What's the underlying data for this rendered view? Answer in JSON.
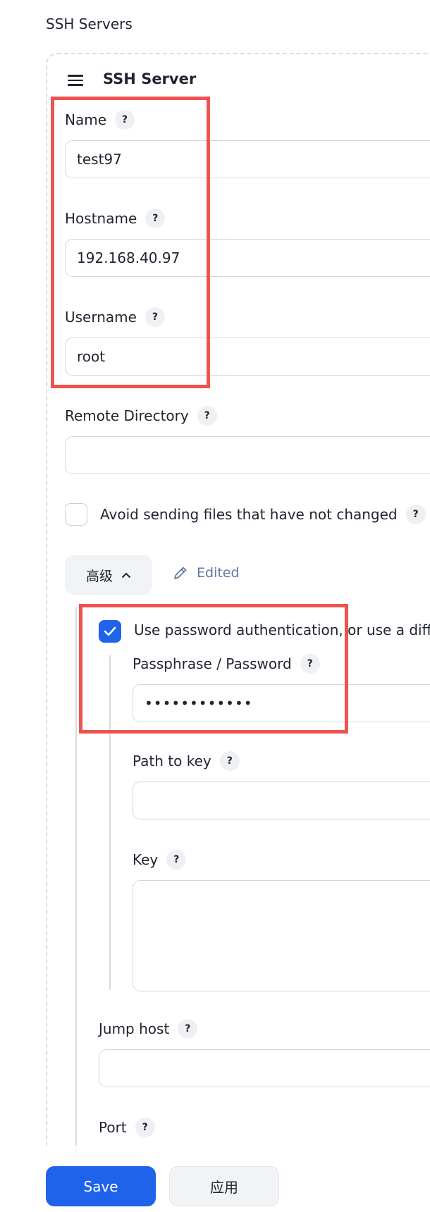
{
  "section": {
    "title": "SSH Servers"
  },
  "card": {
    "title": "SSH Server"
  },
  "fields": {
    "name": {
      "label": "Name",
      "value": "test97"
    },
    "hostname": {
      "label": "Hostname",
      "value": "192.168.40.97"
    },
    "username": {
      "label": "Username",
      "value": "root"
    },
    "remote_directory": {
      "label": "Remote Directory",
      "value": ""
    },
    "avoid_sending": {
      "label": "Avoid sending files that have not changed",
      "checked": false
    }
  },
  "advanced": {
    "button_label": "高级",
    "edited_label": "Edited",
    "use_password": {
      "label": "Use password authentication, or use a diff",
      "checked": true
    },
    "passphrase": {
      "label": "Passphrase / Password",
      "value": "••••••••••••"
    },
    "path_to_key": {
      "label": "Path to key",
      "value": ""
    },
    "key": {
      "label": "Key",
      "value": ""
    },
    "jump_host": {
      "label": "Jump host",
      "value": ""
    },
    "port": {
      "label": "Port"
    }
  },
  "help_mark": "?",
  "footer": {
    "save_label": "Save",
    "apply_label": "应用"
  },
  "colors": {
    "primary": "#1e63e9",
    "highlight": "#ee5350",
    "edited": "#5f7aa0"
  }
}
